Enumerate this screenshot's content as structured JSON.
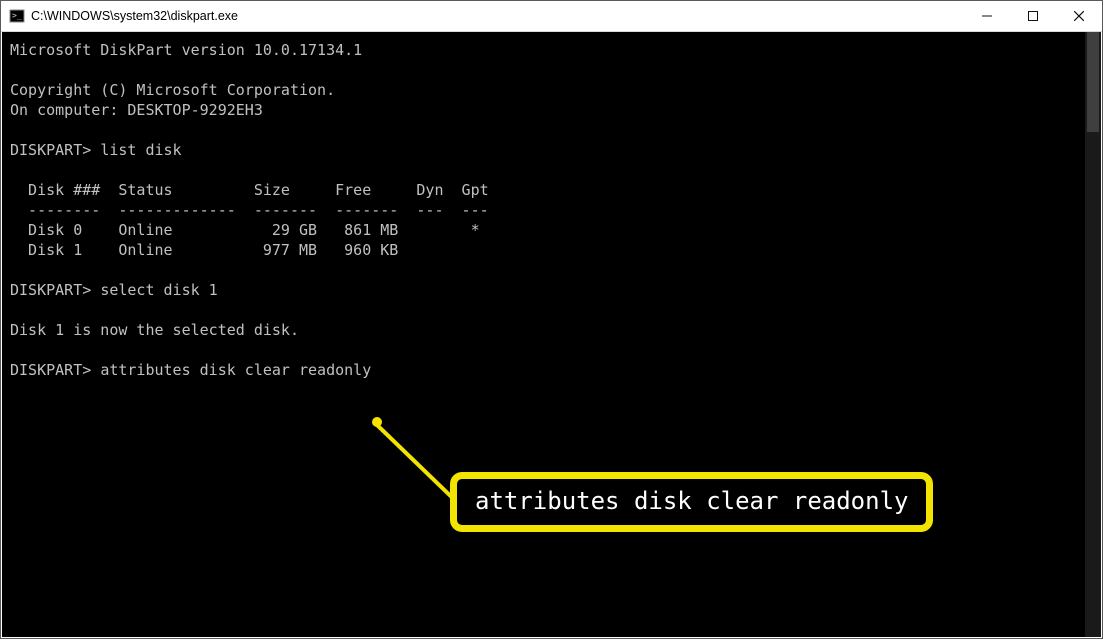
{
  "window": {
    "title": "C:\\WINDOWS\\system32\\diskpart.exe"
  },
  "terminal": {
    "version_line": "Microsoft DiskPart version 10.0.17134.1",
    "copyright_line": "Copyright (C) Microsoft Corporation.",
    "computer_line": "On computer: DESKTOP-9292EH3",
    "prompt": "DISKPART>",
    "cmd_list_disk": "list disk",
    "table": {
      "header": "  Disk ###  Status         Size     Free     Dyn  Gpt",
      "divider": "  --------  -------------  -------  -------  ---  ---",
      "rows": [
        "  Disk 0    Online           29 GB   861 MB        *",
        "  Disk 1    Online          977 MB   960 KB"
      ]
    },
    "cmd_select": "select disk 1",
    "select_result": "Disk 1 is now the selected disk.",
    "cmd_attr": "attributes disk clear readonly"
  },
  "callout": {
    "text": "attributes disk clear readonly"
  }
}
